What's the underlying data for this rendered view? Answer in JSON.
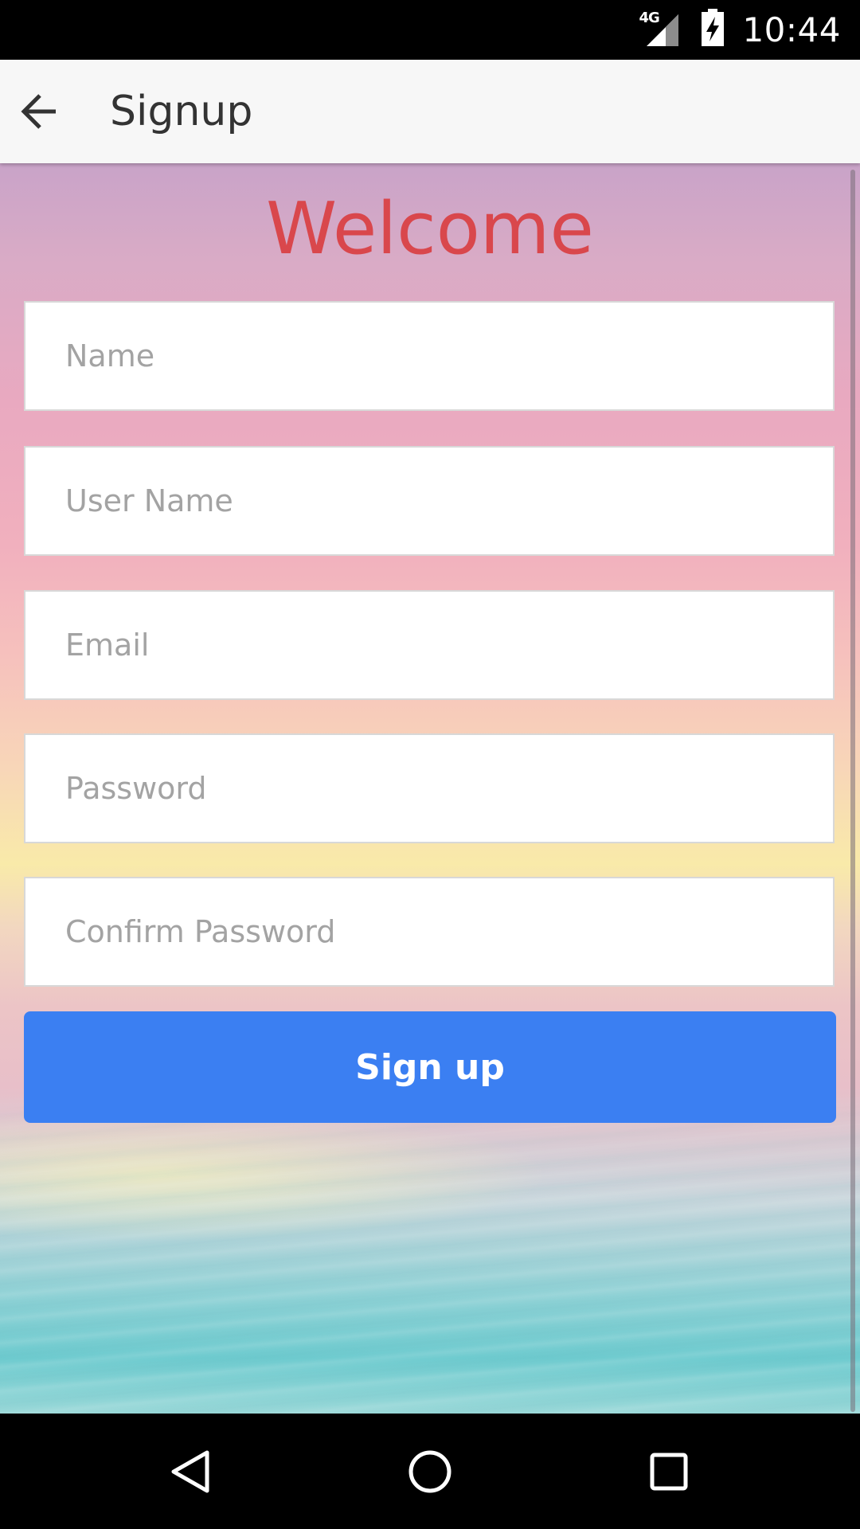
{
  "status_bar": {
    "network": "4G",
    "time": "10:44"
  },
  "app_bar": {
    "title": "Signup"
  },
  "form": {
    "heading": "Welcome",
    "fields": [
      {
        "placeholder": "Name",
        "value": ""
      },
      {
        "placeholder": "User Name",
        "value": ""
      },
      {
        "placeholder": "Email",
        "value": ""
      },
      {
        "placeholder": "Password",
        "value": ""
      },
      {
        "placeholder": "Confirm Password",
        "value": ""
      }
    ],
    "submit_label": "Sign up"
  },
  "colors": {
    "heading": "#d9474c",
    "button": "#3b7ff2",
    "app_bar": "#f7f7f7"
  },
  "icons": {
    "back": "arrow-left",
    "signal": "cell-signal",
    "battery": "battery-charging",
    "nav_back": "triangle-back",
    "nav_home": "circle-home",
    "nav_recents": "square-recents"
  }
}
